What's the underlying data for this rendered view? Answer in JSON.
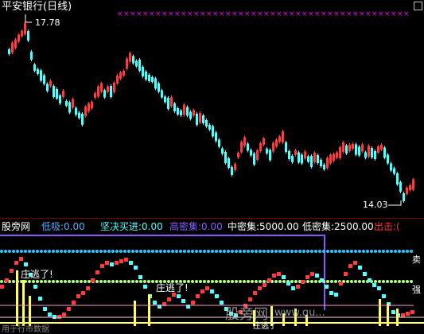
{
  "window": {
    "title": "平安银行(日线)",
    "max_price": "17.78",
    "min_price": "14.03"
  },
  "colors": {
    "up": "#ff3b3b",
    "down": "#54ffff",
    "magenta": "#ff00ff",
    "cyan_dot": "#28c8ff",
    "green_dot": "#b4ff7a",
    "yellow": "#ffff60",
    "purple": "#8855ff"
  },
  "indicator_bar": {
    "name": "股旁网",
    "items": [
      {
        "label": "低吸:",
        "value": "0.00",
        "color": "#55aaff"
      },
      {
        "label": "坚决买进:",
        "value": "0.00",
        "color": "#54ffff"
      },
      {
        "label": "高密集:",
        "value": "0.00",
        "color": "#8a5cff"
      },
      {
        "label": "中密集:",
        "value": "5000.00",
        "color": "#ffffff"
      },
      {
        "label": "低密集:",
        "value": "2500.00",
        "color": "#ffffff"
      },
      {
        "label": "出击:",
        "value": "(",
        "color": "#ff3b3b"
      }
    ]
  },
  "side_labels": {
    "sell": "卖",
    "strong": "强"
  },
  "signals": {
    "escape1": "庄逃了!",
    "escape2": "庄逃了!",
    "escape3": "庄逃了"
  },
  "watermark": {
    "site": "股旁网",
    "domain": "www.gu..."
  },
  "footer": {
    "note": "用于行市数据"
  },
  "chart_data": {
    "type": "candlestick",
    "title": "平安银行(日线)",
    "annotations": [
      {
        "text": "17.78"
      },
      {
        "text": "14.03"
      }
    ],
    "price_range": [
      14.03,
      17.78
    ]
  }
}
